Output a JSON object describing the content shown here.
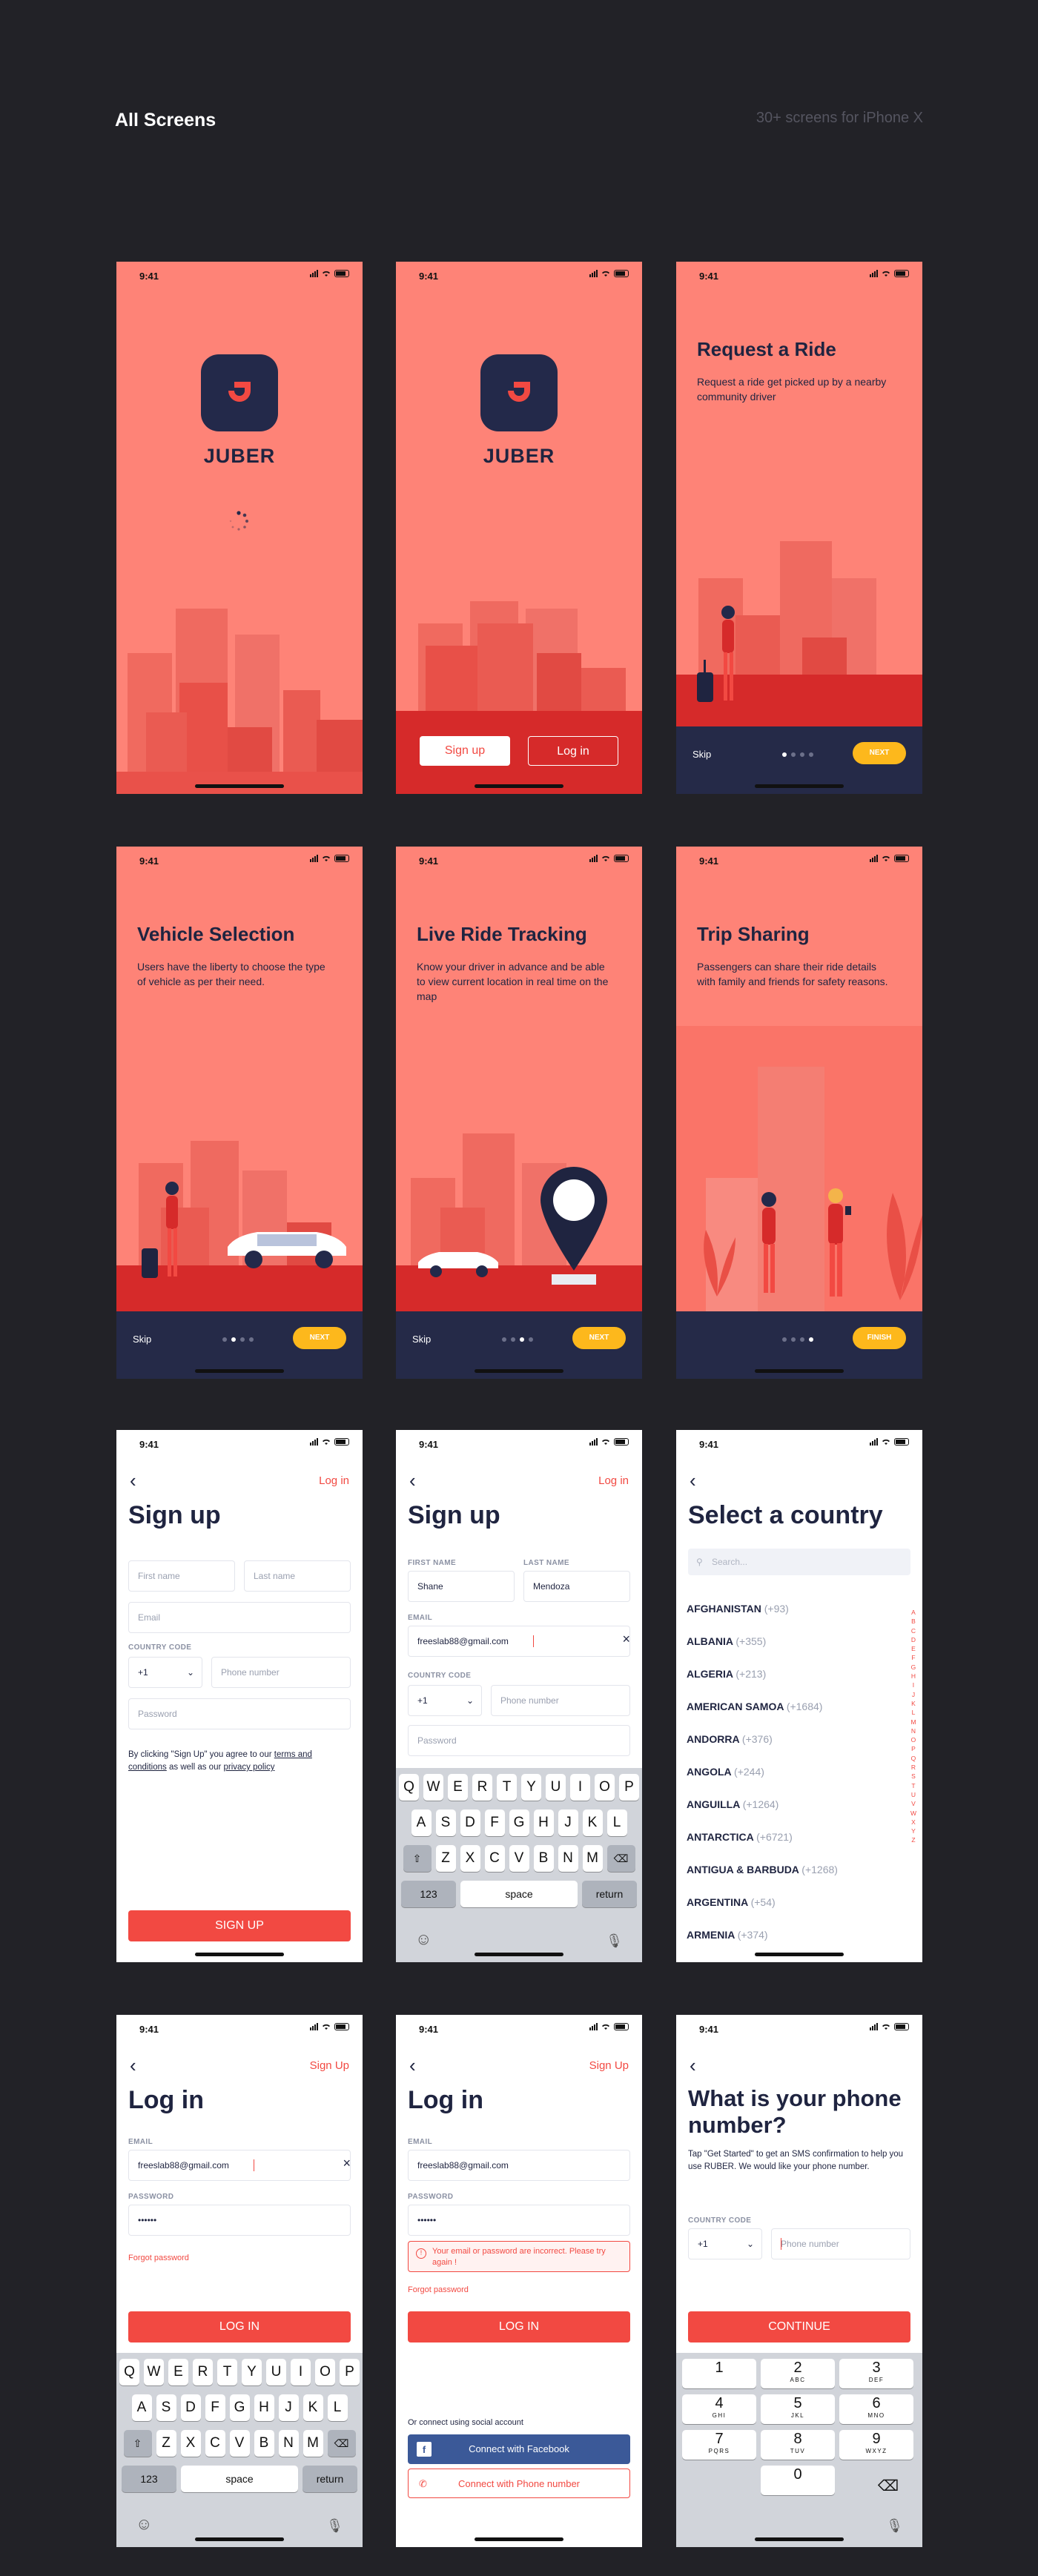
{
  "header": {
    "title": "All Screens",
    "subtitle": "30+ screens for iPhone X"
  },
  "status": {
    "time": "9:41"
  },
  "splash": {
    "brand": "JUBER",
    "signup_label": "Sign up",
    "login_label": "Log in"
  },
  "onboarding": [
    {
      "title": "Request a Ride",
      "text": "Request a ride get picked up by a nearby community driver",
      "skip": "Skip",
      "button": "NEXT",
      "active_dot": 1
    },
    {
      "title": "Vehicle Selection",
      "text": "Users have the liberty to choose the type of vehicle as per their need.",
      "skip": "Skip",
      "button": "NEXT",
      "active_dot": 2
    },
    {
      "title": "Live Ride Tracking",
      "text": "Know your driver in advance and be able to view current location in real time on the map",
      "skip": "Skip",
      "button": "NEXT",
      "active_dot": 3
    },
    {
      "title": "Trip Sharing",
      "text": "Passengers can share their ride details with family and friends for safety reasons.",
      "button": "FINISH",
      "active_dot": 4
    }
  ],
  "signup_empty": {
    "top_link": "Log in",
    "title": "Sign up",
    "first_name_placeholder": "First name",
    "last_name_placeholder": "Last name",
    "email_placeholder": "Email",
    "country_code_label": "COUNTRY CODE",
    "country_code": "+1",
    "phone_placeholder": "Phone number",
    "password_placeholder": "Password",
    "terms_prefix": "By clicking \"Sign Up\" you agree to our ",
    "terms_link": "terms and conditions",
    "terms_mid": " as well as our ",
    "privacy_link": "privacy policy",
    "button": "SIGN UP"
  },
  "signup_filled": {
    "top_link": "Log in",
    "title": "Sign up",
    "first_name_label": "FIRST NAME",
    "first_name": "Shane",
    "last_name_label": "LAST NAME",
    "last_name": "Mendoza",
    "email_label": "EMAIL",
    "email": "freeslab88@gmail.com",
    "country_code_label": "COUNTRY CODE",
    "country_code": "+1",
    "phone_placeholder": "Phone number",
    "password_placeholder": "Password"
  },
  "keyboard": {
    "row1": [
      "Q",
      "W",
      "E",
      "R",
      "T",
      "Y",
      "U",
      "I",
      "O",
      "P"
    ],
    "row2": [
      "A",
      "S",
      "D",
      "F",
      "G",
      "H",
      "J",
      "K",
      "L"
    ],
    "row3": [
      "Z",
      "X",
      "C",
      "V",
      "B",
      "N",
      "M"
    ],
    "num_label": "123",
    "space_label": "space",
    "return_label": "return"
  },
  "country_select": {
    "title": "Select a country",
    "search_placeholder": "Search...",
    "countries": [
      {
        "name": "AFGHANISTAN",
        "code": "(+93)"
      },
      {
        "name": "ALBANIA",
        "code": "(+355)"
      },
      {
        "name": "ALGERIA",
        "code": "(+213)"
      },
      {
        "name": "AMERICAN SAMOA",
        "code": "(+1684)"
      },
      {
        "name": "ANDORRA",
        "code": "(+376)"
      },
      {
        "name": "ANGOLA",
        "code": "(+244)"
      },
      {
        "name": "ANGUILLA",
        "code": "(+1264)"
      },
      {
        "name": "ANTARCTICA",
        "code": "(+6721)"
      },
      {
        "name": "ANTIGUA & BARBUDA",
        "code": "(+1268)"
      },
      {
        "name": "ARGENTINA",
        "code": "(+54)"
      },
      {
        "name": "ARMENIA",
        "code": "(+374)"
      }
    ],
    "alphabet": [
      "A",
      "B",
      "C",
      "D",
      "E",
      "F",
      "G",
      "H",
      "I",
      "J",
      "K",
      "L",
      "M",
      "N",
      "O",
      "P",
      "Q",
      "R",
      "S",
      "T",
      "U",
      "V",
      "W",
      "X",
      "Y",
      "Z"
    ]
  },
  "login_typing": {
    "top_link": "Sign Up",
    "title": "Log in",
    "email_label": "EMAIL",
    "email": "freeslab88@gmail.com",
    "password_label": "PASSWORD",
    "password": "••••••",
    "forgot": "Forgot password",
    "button": "LOG IN"
  },
  "login_error": {
    "top_link": "Sign Up",
    "title": "Log in",
    "email_label": "EMAIL",
    "email": "freeslab88@gmail.com",
    "password_label": "PASSWORD",
    "password": "••••••",
    "error": "Your email or password are incorrect. Please try again !",
    "forgot": "Forgot password",
    "button": "LOG IN",
    "social_label": "Or connect using social account",
    "facebook": "Connect with Facebook",
    "phone": "Connect with Phone number"
  },
  "phone_entry": {
    "title": "What is your phone number?",
    "text": "Tap \"Get Started\" to get an SMS confirmation to help you use RUBER. We would like your phone number.",
    "country_code_label": "COUNTRY CODE",
    "country_code": "+1",
    "phone_placeholder": "Phone number",
    "button": "CONTINUE",
    "keys": [
      {
        "num": "1",
        "letters": ""
      },
      {
        "num": "2",
        "letters": "ABC"
      },
      {
        "num": "3",
        "letters": "DEF"
      },
      {
        "num": "4",
        "letters": "GHI"
      },
      {
        "num": "5",
        "letters": "JKL"
      },
      {
        "num": "6",
        "letters": "MNO"
      },
      {
        "num": "7",
        "letters": "PQRS"
      },
      {
        "num": "8",
        "letters": "TUV"
      },
      {
        "num": "9",
        "letters": "WXYZ"
      },
      {
        "num": "0",
        "letters": ""
      }
    ]
  },
  "colors": {
    "background": "#222227",
    "coral": "#fe8377",
    "red": "#f24942",
    "navy": "#252a48",
    "yellow": "#fdb81c"
  }
}
